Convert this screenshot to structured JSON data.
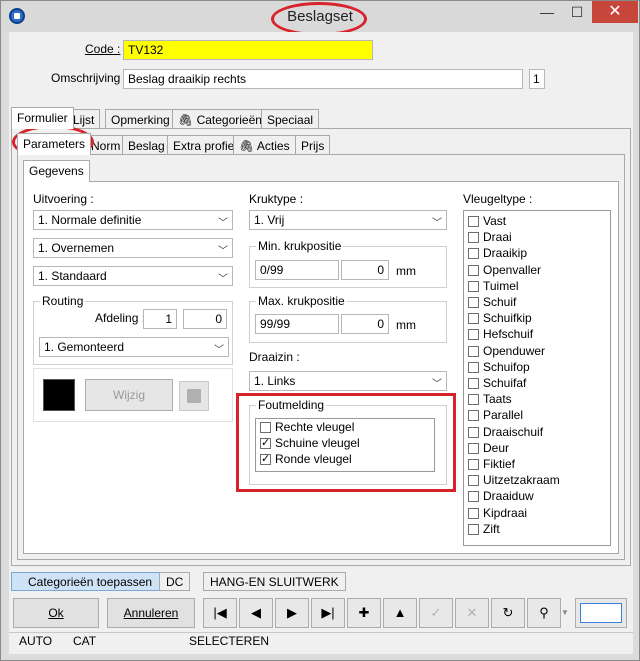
{
  "window": {
    "title": "Beslagset"
  },
  "header": {
    "code_label": "Code :",
    "code_value": "TV132",
    "omschrijving_label": "Omschrijving :",
    "omschrijving_value": "Beslag draaikip rechts",
    "omschrijving_count": "1"
  },
  "tabs_top": [
    "Formulier",
    "Lijst",
    "Opmerking",
    "Categorieën",
    "Speciaal"
  ],
  "tabs_sub": [
    "Parameters",
    "Norm",
    "Beslag",
    "Extra profiel",
    "Acties",
    "Prijs"
  ],
  "tab_gegevens": "Gegevens",
  "uitvoering": {
    "label": "Uitvoering :",
    "select1": "1.  Normale definitie",
    "select2": "1.  Overnemen",
    "select3": "1.  Standaard"
  },
  "routing": {
    "label": "Routing",
    "afdeling_label": "Afdeling :",
    "afdeling_val1": "1",
    "afdeling_val2": "0",
    "select": "1.  Gemonteerd"
  },
  "color": {
    "swatch": "#000000",
    "wijzig_label": "Wijzig",
    "accent": "#b0b0b0"
  },
  "kruktype": {
    "label": "Kruktype :",
    "select": "1.  Vrij",
    "min_label": "Min. krukpositie",
    "min_value": "0/99",
    "min_mm": "0",
    "max_label": "Max. krukpositie",
    "max_value": "99/99",
    "max_mm": "0",
    "unit": "mm"
  },
  "draaizin": {
    "label": "Draaizin :",
    "select": "1.  Links"
  },
  "foutmelding": {
    "label": "Foutmelding",
    "items": [
      {
        "label": "Rechte vleugel",
        "checked": false
      },
      {
        "label": "Schuine vleugel",
        "checked": true
      },
      {
        "label": "Ronde vleugel",
        "checked": true
      }
    ]
  },
  "vleugeltype": {
    "label": "Vleugeltype :",
    "items": [
      "Vast",
      "Draai",
      "Draaikip",
      "Openvaller",
      "Tuimel",
      "Schuif",
      "Schuifkip",
      "Hefschuif",
      "Openduwer",
      "Schuifop",
      "Schuifaf",
      "Taats",
      "Parallel",
      "Draaischuif",
      "Deur",
      "Fiktief",
      "Uitzetzakraam",
      "Draaiduw",
      "Kipdraai",
      "Zift"
    ]
  },
  "bottom_tabs": [
    "Categorieën toepassen",
    "DC",
    "HANG-EN SLUITWERK"
  ],
  "buttons": {
    "ok": "Ok",
    "annuleren": "Annuleren"
  },
  "nav": [
    "|◀",
    "◀",
    "▶",
    "▶|",
    "✚",
    "▲",
    "✓",
    "✕",
    "↻",
    "⚲"
  ],
  "status": [
    "AUTO",
    "CAT",
    "SELECTEREN"
  ]
}
